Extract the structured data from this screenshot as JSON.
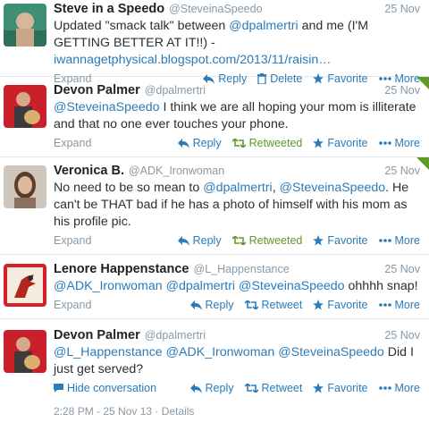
{
  "tweets": [
    {
      "name": "Steve in a Speedo",
      "handle": "@SteveinaSpeedo",
      "time": "25 Nov",
      "text_parts": [
        "Updated \"smack talk\" between ",
        "@dpalmertri",
        " and me (I'M GETTING BETTER AT IT!!) - ",
        "iwannagetphysical.blogspot.com/2013/11/raisin…"
      ],
      "left_action": "Expand",
      "actions": {
        "reply": "Reply",
        "second": "Delete",
        "favorite": "Favorite",
        "more": "More"
      }
    },
    {
      "name": "Devon Palmer",
      "handle": "@dpalmertri",
      "time": "25 Nov",
      "text_parts": [
        "@SteveinaSpeedo",
        " I think we are all hoping your mom is illiterate and that no one ever touches your phone."
      ],
      "left_action": "Expand",
      "actions": {
        "reply": "Reply",
        "second": "Retweeted",
        "favorite": "Favorite",
        "more": "More"
      }
    },
    {
      "name": "Veronica B.",
      "handle": "@ADK_Ironwoman",
      "time": "25 Nov",
      "text_parts": [
        "No need to be so mean to ",
        "@dpalmertri",
        ", ",
        "@SteveinaSpeedo",
        ". He can't be THAT bad if he has a photo of himself with his mom as his profile pic."
      ],
      "left_action": "Expand",
      "actions": {
        "reply": "Reply",
        "second": "Retweeted",
        "favorite": "Favorite",
        "more": "More"
      }
    },
    {
      "name": "Lenore Happenstance",
      "handle": "@L_Happenstance",
      "time": "25 Nov",
      "text_parts": [
        "@ADK_Ironwoman",
        " ",
        "@dpalmertri",
        " ",
        "@SteveinaSpeedo",
        " ohhhh snap!"
      ],
      "left_action": "Expand",
      "actions": {
        "reply": "Reply",
        "second": "Retweet",
        "favorite": "Favorite",
        "more": "More"
      }
    },
    {
      "name": "Devon Palmer",
      "handle": "@dpalmertri",
      "time": "25 Nov",
      "text_parts": [
        "@L_Happenstance",
        " ",
        "@ADK_Ironwoman",
        " ",
        "@SteveinaSpeedo",
        " Did I just get served?"
      ],
      "left_action": "Hide conversation",
      "actions": {
        "reply": "Reply",
        "second": "Retweet",
        "favorite": "Favorite",
        "more": "More"
      }
    }
  ],
  "details": "2:28 PM - 25 Nov 13 · Details",
  "colors": {
    "link": "#2b7bb9",
    "retweeted": "#609928",
    "muted": "#8899a6"
  }
}
